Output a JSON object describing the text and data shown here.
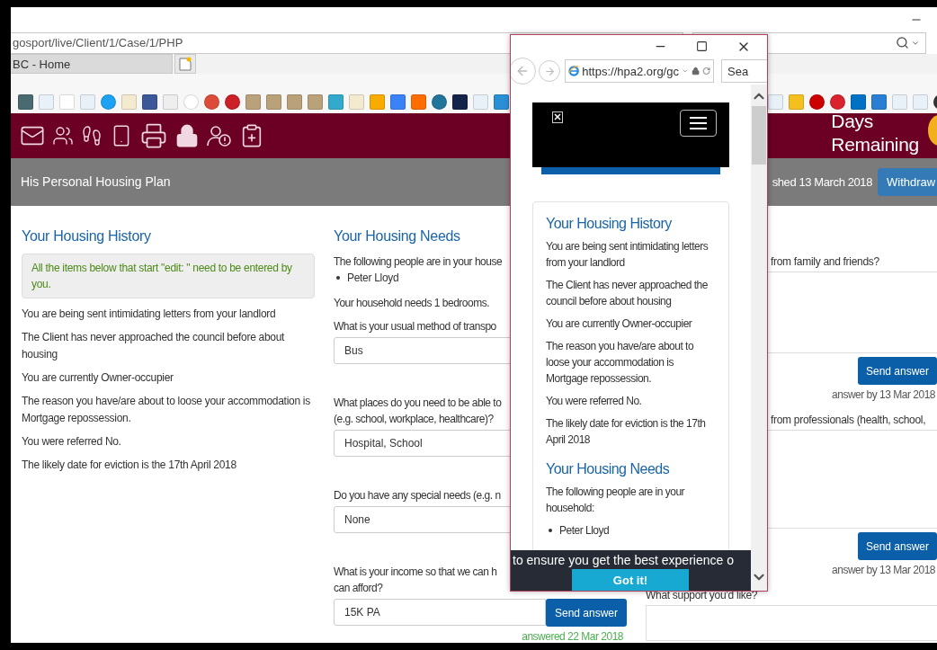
{
  "browser": {
    "address": "gosport/live/Client/1/Case/1/PHP",
    "tabs": [
      {
        "label": "BC - Home",
        "selected": true
      }
    ]
  },
  "header": {
    "days_lines": [
      "Days",
      "Remaining"
    ]
  },
  "plan_bar": {
    "title": "His Personal Housing Plan",
    "published": "shed 13 March 2018",
    "action": "Withdraw"
  },
  "history": {
    "heading": "Your Housing History",
    "notice": "All the items below that start \"edit: \" need to be entered by you.",
    "items": [
      "You are being sent intimidating letters from your landlord",
      "The Client has never approached the council before about housing",
      "You are currently Owner-occupier",
      "The reason you have/are about to loose your accommodation is Mortgage repossession.",
      "You were referred No.",
      "The likely date for eviction is the 17th April 2018"
    ]
  },
  "needs": {
    "heading": "Your Housing Needs",
    "intro": "The following people are in your house",
    "people": [
      "Peter Lloyd"
    ],
    "bedrooms": "Your household needs 1 bedrooms.",
    "questions": [
      {
        "kind": "field",
        "label_lines": [
          "What is your usual method of transpo"
        ],
        "value": "Bus"
      },
      {
        "kind": "field",
        "label_lines": [
          "What places do you need to be able to",
          "(e.g. school, workplace, healthcare)?"
        ],
        "value": "Hospital, School"
      },
      {
        "kind": "field",
        "label_lines": [
          "Do you have any special needs (e.g. n"
        ],
        "value": "None"
      },
      {
        "kind": "answer",
        "label_lines": [
          "What is your income so that we can h",
          "can afford?"
        ],
        "value": "15K PA",
        "button": "Send answer",
        "status": "answered 22 Mar 2018",
        "answered": true
      }
    ]
  },
  "support": {
    "questions": [
      {
        "kind": "answer",
        "label": "from family and friends?",
        "button": "Send answer",
        "status": "answer by 13 Mar 2018",
        "answered": false
      },
      {
        "kind": "answer",
        "label": "from professionals (health, school,",
        "button": "Send answer",
        "status": "answer by 13 Mar 2018",
        "answered": false
      },
      {
        "kind": "open",
        "label": "What support you’d like?"
      }
    ]
  },
  "popup": {
    "url": "https://hpa2.org/gc",
    "search_placeholder": "Sea",
    "sections": [
      {
        "heading": "Your Housing History",
        "paragraphs": [
          "You are being sent intimidating letters from your landlord",
          "The Client has never approached the council before about housing",
          "You are currently Owner-occupier",
          "The reason you have/are about to loose your accommodation is Mortgage repossession.",
          "You were referred No.",
          "The likely date for eviction is the 17th April 2018"
        ]
      },
      {
        "heading": "Your Housing Needs",
        "paragraphs": [
          "The following people are in your household:"
        ],
        "people": [
          "Peter Lloyd"
        ]
      }
    ],
    "cookie": {
      "text": "to ensure you get the best experience o",
      "button": "Got it!"
    }
  }
}
